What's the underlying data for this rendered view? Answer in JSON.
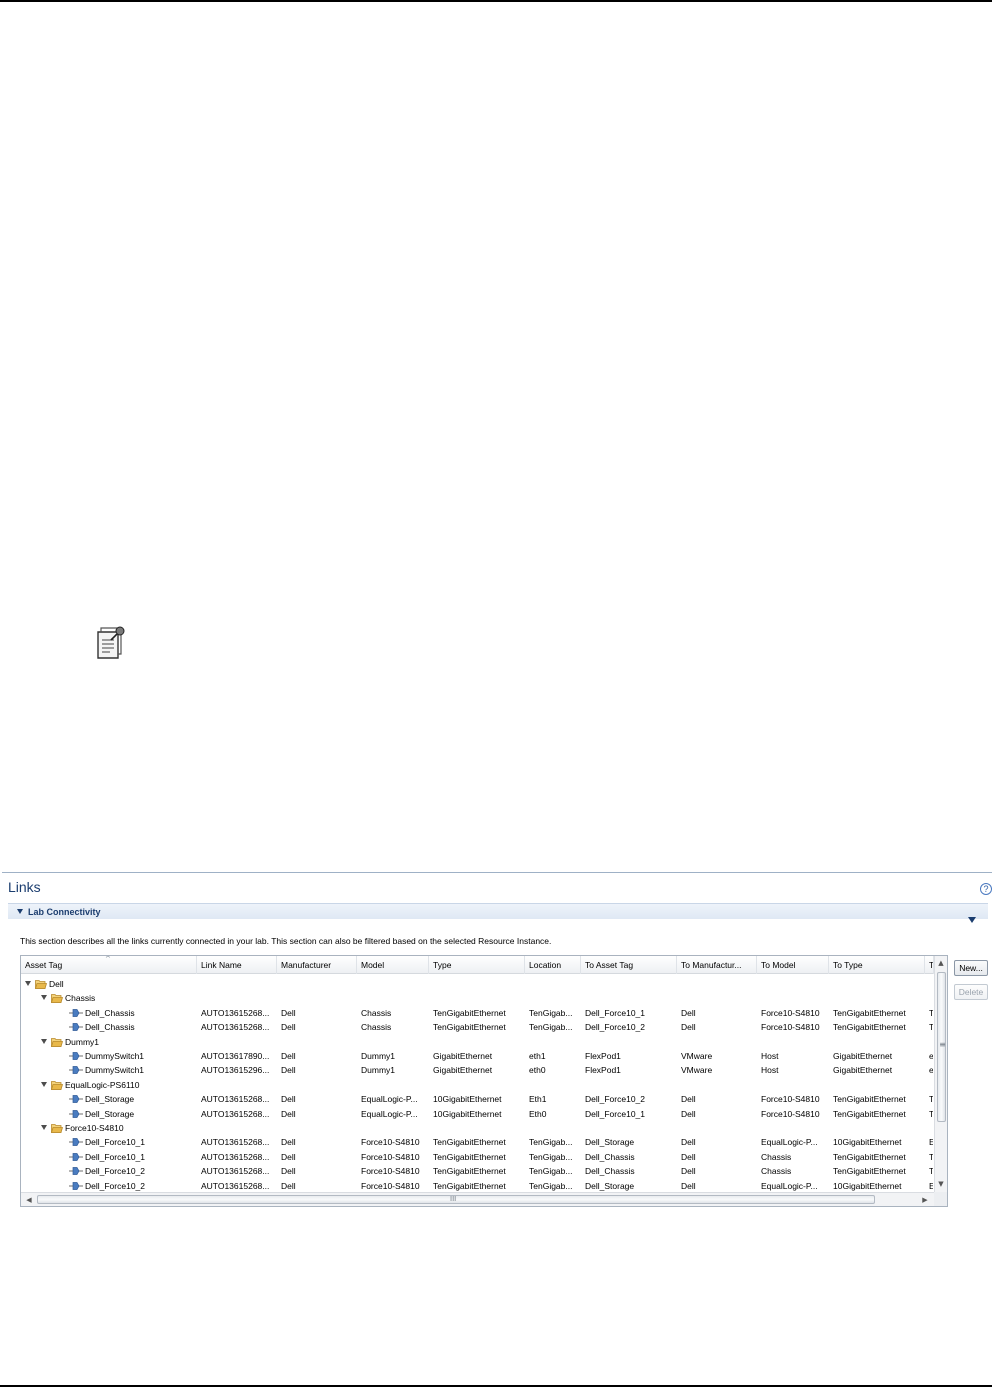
{
  "panel": {
    "title": "Links",
    "help_glyph": "?",
    "section_title": "Lab Connectivity",
    "section_description": "This section describes all the links currently connected in your lab. This section can also be filtered based on the selected Resource Instance."
  },
  "table": {
    "columns": [
      "Asset Tag",
      "Link Name",
      "Manufacturer",
      "Model",
      "Type",
      "Location",
      "To Asset Tag",
      "To Manufactur...",
      "To Model",
      "To Type",
      "T"
    ],
    "rows": [
      {
        "level": 0,
        "kind": "folder",
        "label": "Dell",
        "cells": [
          "",
          "",
          "",
          "",
          "",
          "",
          "",
          "",
          "",
          ""
        ]
      },
      {
        "level": 1,
        "kind": "folder",
        "label": "Chassis",
        "cells": [
          "",
          "",
          "",
          "",
          "",
          "",
          "",
          "",
          "",
          ""
        ]
      },
      {
        "level": 2,
        "kind": "link",
        "label": "Dell_Chassis",
        "cells": [
          "AUTO13615268...",
          "Dell",
          "Chassis",
          "TenGigabitEthernet",
          "TenGigab...",
          "Dell_Force10_1",
          "Dell",
          "Force10-S4810",
          "TenGigabitEthernet",
          "T"
        ]
      },
      {
        "level": 2,
        "kind": "link",
        "label": "Dell_Chassis",
        "cells": [
          "AUTO13615268...",
          "Dell",
          "Chassis",
          "TenGigabitEthernet",
          "TenGigab...",
          "Dell_Force10_2",
          "Dell",
          "Force10-S4810",
          "TenGigabitEthernet",
          "T"
        ]
      },
      {
        "level": 1,
        "kind": "folder",
        "label": "Dummy1",
        "cells": [
          "",
          "",
          "",
          "",
          "",
          "",
          "",
          "",
          "",
          ""
        ]
      },
      {
        "level": 2,
        "kind": "link",
        "label": "DummySwitch1",
        "cells": [
          "AUTO13617890...",
          "Dell",
          "Dummy1",
          "GigabitEthernet",
          "eth1",
          "FlexPod1",
          "VMware",
          "Host",
          "GigabitEthernet",
          "e"
        ]
      },
      {
        "level": 2,
        "kind": "link",
        "label": "DummySwitch1",
        "cells": [
          "AUTO13615296...",
          "Dell",
          "Dummy1",
          "GigabitEthernet",
          "eth0",
          "FlexPod1",
          "VMware",
          "Host",
          "GigabitEthernet",
          "e"
        ]
      },
      {
        "level": 1,
        "kind": "folder",
        "label": "EqualLogic-PS6110",
        "cells": [
          "",
          "",
          "",
          "",
          "",
          "",
          "",
          "",
          "",
          ""
        ]
      },
      {
        "level": 2,
        "kind": "link",
        "label": "Dell_Storage",
        "cells": [
          "AUTO13615268...",
          "Dell",
          "EqualLogic-P...",
          "10GigabitEthernet",
          "Eth1",
          "Dell_Force10_2",
          "Dell",
          "Force10-S4810",
          "TenGigabitEthernet",
          "T"
        ]
      },
      {
        "level": 2,
        "kind": "link",
        "label": "Dell_Storage",
        "cells": [
          "AUTO13615268...",
          "Dell",
          "EqualLogic-P...",
          "10GigabitEthernet",
          "Eth0",
          "Dell_Force10_1",
          "Dell",
          "Force10-S4810",
          "TenGigabitEthernet",
          "T"
        ]
      },
      {
        "level": 1,
        "kind": "folder",
        "label": "Force10-S4810",
        "cells": [
          "",
          "",
          "",
          "",
          "",
          "",
          "",
          "",
          "",
          ""
        ]
      },
      {
        "level": 2,
        "kind": "link",
        "label": "Dell_Force10_1",
        "cells": [
          "AUTO13615268...",
          "Dell",
          "Force10-S4810",
          "TenGigabitEthernet",
          "TenGigab...",
          "Dell_Storage",
          "Dell",
          "EqualLogic-P...",
          "10GigabitEthernet",
          "E"
        ]
      },
      {
        "level": 2,
        "kind": "link",
        "label": "Dell_Force10_1",
        "cells": [
          "AUTO13615268...",
          "Dell",
          "Force10-S4810",
          "TenGigabitEthernet",
          "TenGigab...",
          "Dell_Chassis",
          "Dell",
          "Chassis",
          "TenGigabitEthernet",
          "T"
        ]
      },
      {
        "level": 2,
        "kind": "link",
        "label": "Dell_Force10_2",
        "cells": [
          "AUTO13615268...",
          "Dell",
          "Force10-S4810",
          "TenGigabitEthernet",
          "TenGigab...",
          "Dell_Chassis",
          "Dell",
          "Chassis",
          "TenGigabitEthernet",
          "T"
        ]
      },
      {
        "level": 2,
        "kind": "link",
        "label": "Dell_Force10_2",
        "cells": [
          "AUTO13615268...",
          "Dell",
          "Force10-S4810",
          "TenGigabitEthernet",
          "TenGigab...",
          "Dell_Storage",
          "Dell",
          "EqualLogic-P...",
          "10GigabitEthernet",
          "E"
        ]
      }
    ]
  },
  "buttons": {
    "new_label": "New...",
    "delete_label": "Delete"
  },
  "scrollbar": {
    "h_grip": "III",
    "v_grip": "≡",
    "up_arrow": "▲",
    "down_arrow": "▼",
    "left_arrow": "◀",
    "right_arrow": "▶"
  },
  "icons": {
    "note": "note-pushpin-icon",
    "folder": "folder-open-icon",
    "link": "link-connector-icon",
    "help": "help-icon"
  },
  "colors": {
    "panel_title": "#1b3d6f",
    "section_bar": "#dfe8f4",
    "folder": "#e8b84a",
    "link_icon": "#4a7cc0"
  }
}
